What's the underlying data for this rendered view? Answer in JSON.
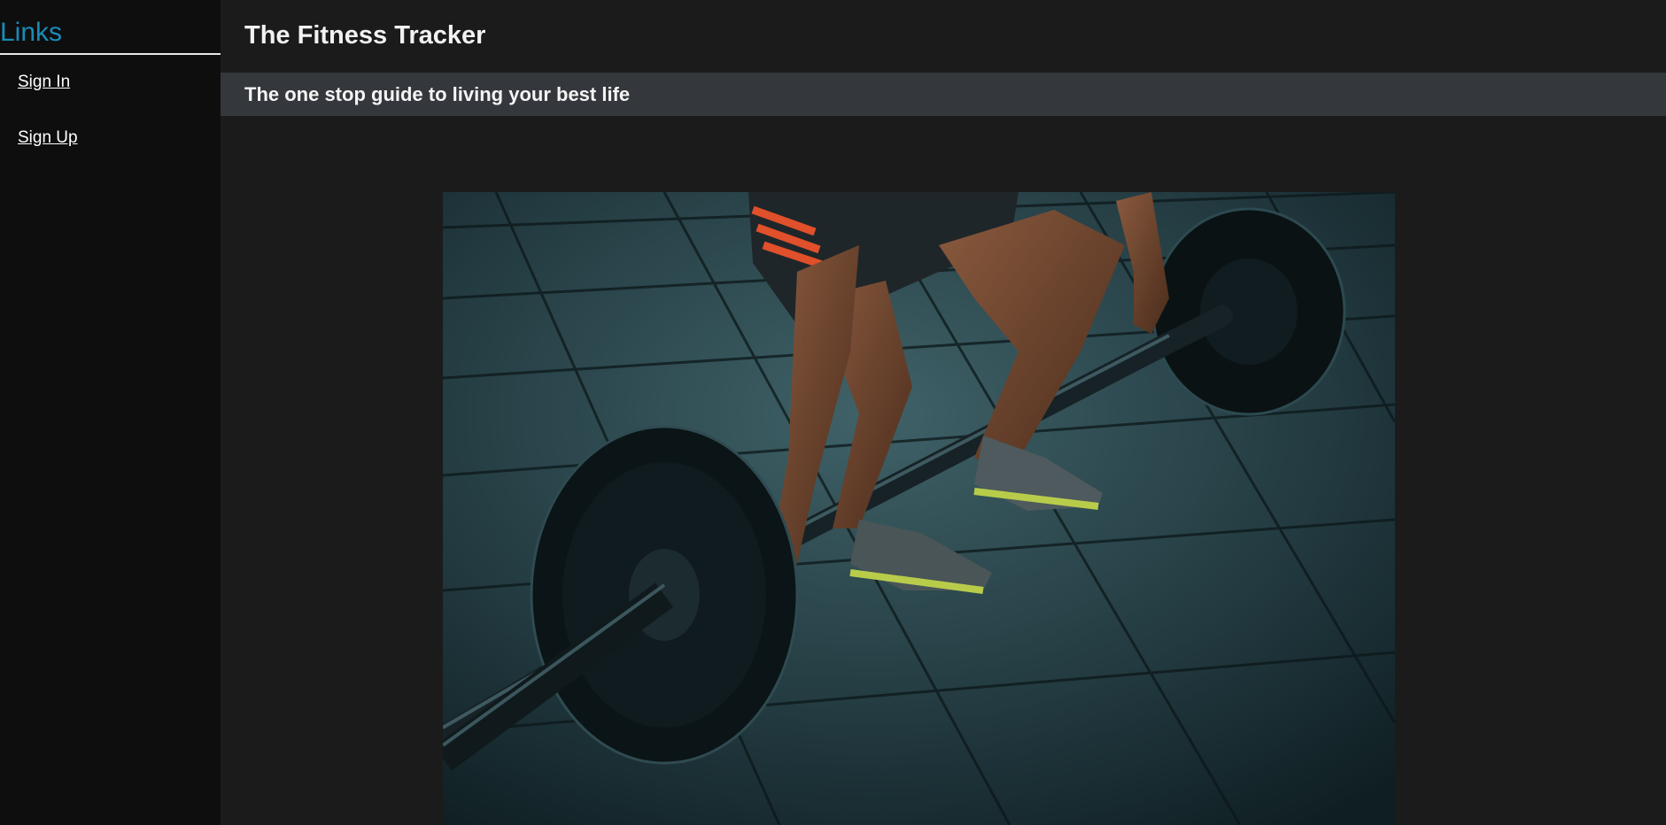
{
  "sidebar": {
    "title": "Links",
    "links": [
      {
        "label": "Sign In"
      },
      {
        "label": "Sign Up"
      }
    ]
  },
  "header": {
    "title": "The Fitness Tracker",
    "subtitle": "The one stop guide to living your best life"
  },
  "hero": {
    "icon": "barbell-deadlift-photo"
  },
  "colors": {
    "accent": "#1a8bb8",
    "background": "#1b1b1b",
    "sidebar": "#0e0e0e",
    "subheader": "#34373b"
  }
}
